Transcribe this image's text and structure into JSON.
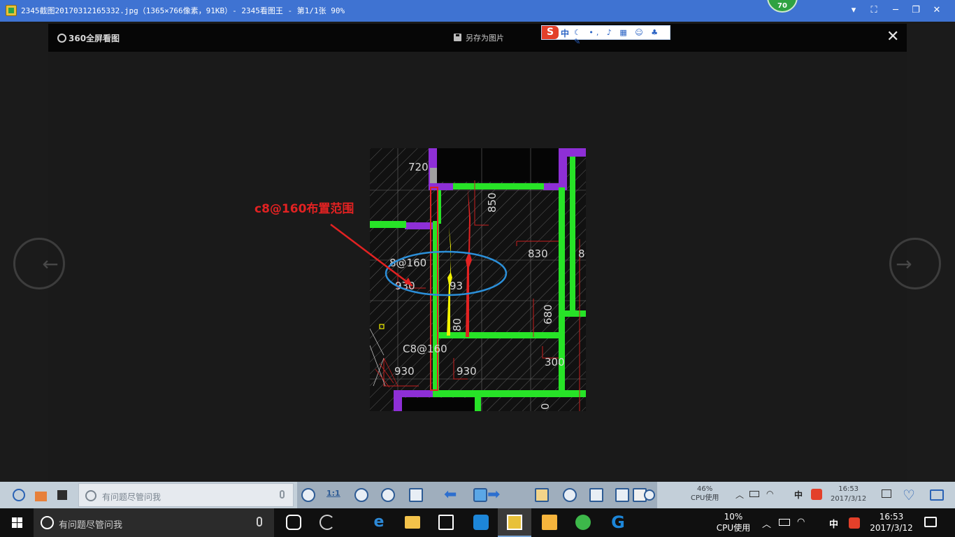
{
  "window": {
    "title": "2345截图20170312165332.jpg（1365×766像素，91KB）- 2345看图王 - 第1/1张 90%",
    "score_badge": "70",
    "controls": [
      "dropdown",
      "fullscreen",
      "minimize",
      "restore",
      "close"
    ]
  },
  "viewer": {
    "brand": "360全屏看图",
    "save_label": "另存为图片",
    "ime_label": "中",
    "ime_logo": "S"
  },
  "drawing": {
    "annotation": "c8@160布置范围",
    "labels": {
      "l720": "720",
      "l850": "850",
      "l830": "830",
      "l8x": "8",
      "l8at160": "8@160",
      "l930a": "930",
      "l93": "93",
      "l680": "680",
      "lc8at160": "C8@160",
      "l930b": "930",
      "l930c": "930",
      "l300": "300",
      "l0": "0",
      "l80": "80"
    },
    "colors": {
      "wall_green": "#27e327",
      "wall_purple": "#8e2fd6",
      "red": "#e22222",
      "yellow": "#f2f200",
      "blue_ellipse": "#2b8fd9",
      "hatch": "#7a7a7a"
    }
  },
  "inner_taskbar": {
    "search_placeholder": "有问题尽管问我",
    "ratio_label": "1:1",
    "cpu_percent": "46%",
    "cpu_label": "CPU使用",
    "ime": "中",
    "time": "16:53",
    "date": "2017/3/12"
  },
  "taskbar": {
    "search_placeholder": "有问题尽管问我",
    "cpu_percent": "10%",
    "cpu_label": "CPU使用",
    "ime": "中",
    "time": "16:53",
    "date": "2017/3/12"
  }
}
